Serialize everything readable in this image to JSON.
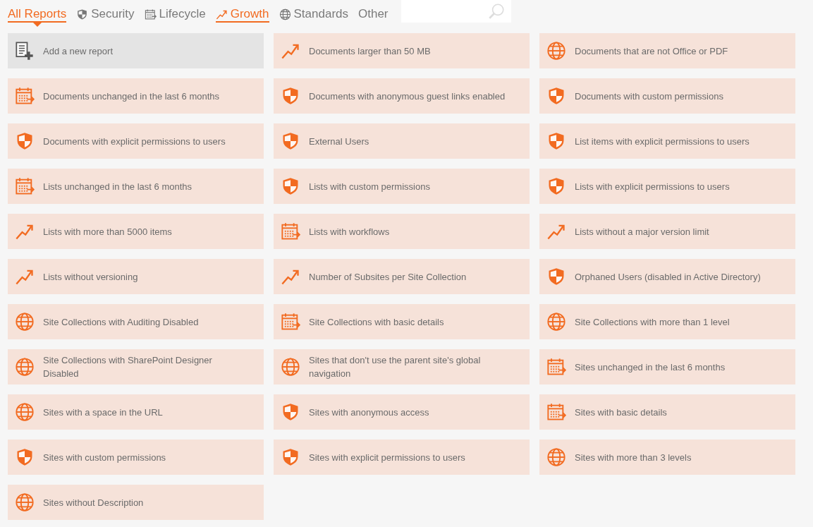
{
  "tabs": [
    {
      "label": "All Reports",
      "kind": "none",
      "selected": true,
      "highlighted": false
    },
    {
      "label": "Security",
      "kind": "security",
      "selected": false,
      "highlighted": false
    },
    {
      "label": "Lifecycle",
      "kind": "lifecycle",
      "selected": false,
      "highlighted": false
    },
    {
      "label": "Growth",
      "kind": "growth",
      "selected": false,
      "highlighted": true
    },
    {
      "label": "Standards",
      "kind": "standards",
      "selected": false,
      "highlighted": false
    },
    {
      "label": "Other",
      "kind": "none",
      "selected": false,
      "highlighted": false
    }
  ],
  "reports": [
    {
      "kind": "add",
      "label": "Add a new report"
    },
    {
      "kind": "growth",
      "label": "Documents larger than 50 MB"
    },
    {
      "kind": "standards",
      "label": "Documents that are not Office or PDF"
    },
    {
      "kind": "lifecycle",
      "label": "Documents unchanged in the last 6 months"
    },
    {
      "kind": "security",
      "label": "Documents with anonymous guest links enabled"
    },
    {
      "kind": "security",
      "label": "Documents with custom permissions"
    },
    {
      "kind": "security",
      "label": "Documents with explicit permissions to users"
    },
    {
      "kind": "security",
      "label": "External Users"
    },
    {
      "kind": "security",
      "label": "List items with explicit permissions to users"
    },
    {
      "kind": "lifecycle",
      "label": "Lists unchanged in the last 6 months"
    },
    {
      "kind": "security",
      "label": "Lists with custom permissions"
    },
    {
      "kind": "security",
      "label": "Lists with explicit permissions to users"
    },
    {
      "kind": "growth",
      "label": "Lists with more than 5000 items"
    },
    {
      "kind": "lifecycle",
      "label": "Lists with workflows"
    },
    {
      "kind": "growth",
      "label": "Lists without a major version limit"
    },
    {
      "kind": "growth",
      "label": "Lists without versioning"
    },
    {
      "kind": "growth",
      "label": "Number of Subsites per Site Collection"
    },
    {
      "kind": "security",
      "label": "Orphaned Users (disabled in Active Directory)"
    },
    {
      "kind": "standards",
      "label": "Site Collections with Auditing Disabled"
    },
    {
      "kind": "lifecycle",
      "label": "Site Collections with basic details"
    },
    {
      "kind": "standards",
      "label": "Site Collections with more than 1 level"
    },
    {
      "kind": "standards",
      "label": "Site Collections with SharePoint Designer Disabled"
    },
    {
      "kind": "standards",
      "label": "Sites that don't use the parent site's global navigation"
    },
    {
      "kind": "lifecycle",
      "label": "Sites unchanged in the last 6 months"
    },
    {
      "kind": "standards",
      "label": "Sites with a space in the URL"
    },
    {
      "kind": "security",
      "label": "Sites with anonymous access"
    },
    {
      "kind": "lifecycle",
      "label": "Sites with basic details"
    },
    {
      "kind": "security",
      "label": "Sites with custom permissions"
    },
    {
      "kind": "security",
      "label": "Sites with explicit permissions to users"
    },
    {
      "kind": "standards",
      "label": "Sites with more than 3 levels"
    },
    {
      "kind": "standards",
      "label": "Sites without Description"
    }
  ]
}
